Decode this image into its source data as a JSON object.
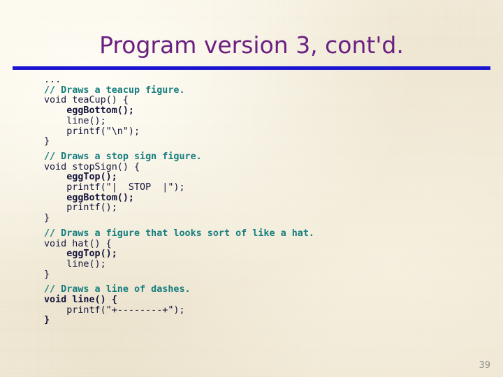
{
  "slide": {
    "title": "Program version 3, cont'd.",
    "page_number": "39",
    "colors": {
      "background": "#f3ecdb",
      "title": "#6b1f80",
      "rule": "#1a13cf",
      "code": "#14143c",
      "comment": "#167e7e",
      "page_number": "#8e8e8e"
    }
  },
  "code": {
    "language": "c",
    "lines": [
      {
        "text": "...",
        "style": "code"
      },
      {
        "text": "// Draws a teacup figure.",
        "style": "comment"
      },
      {
        "text": "void teaCup() {",
        "style": "code"
      },
      {
        "text": "    eggBottom();",
        "style": "code-bold"
      },
      {
        "text": "    line();",
        "style": "code"
      },
      {
        "text": "    printf(\"\\n\");",
        "style": "code"
      },
      {
        "text": "}",
        "style": "code"
      },
      {
        "text": "",
        "style": "blank"
      },
      {
        "text": "// Draws a stop sign figure.",
        "style": "comment"
      },
      {
        "text": "void stopSign() {",
        "style": "code"
      },
      {
        "text": "    eggTop();",
        "style": "code-bold"
      },
      {
        "text": "    printf(\"|  STOP  |\");",
        "style": "code"
      },
      {
        "text": "    eggBottom();",
        "style": "code-bold"
      },
      {
        "text": "    printf();",
        "style": "code"
      },
      {
        "text": "}",
        "style": "code"
      },
      {
        "text": "",
        "style": "blank"
      },
      {
        "text": "// Draws a figure that looks sort of like a hat.",
        "style": "comment"
      },
      {
        "text": "void hat() {",
        "style": "code"
      },
      {
        "text": "    eggTop();",
        "style": "code-bold"
      },
      {
        "text": "    line();",
        "style": "code"
      },
      {
        "text": "}",
        "style": "code"
      },
      {
        "text": "",
        "style": "blank"
      },
      {
        "text": "// Draws a line of dashes.",
        "style": "comment"
      },
      {
        "text": "void line() {",
        "style": "code-bold"
      },
      {
        "text": "    printf(\"+--------+\");",
        "style": "code"
      },
      {
        "text": "}",
        "style": "code-bold"
      }
    ]
  }
}
